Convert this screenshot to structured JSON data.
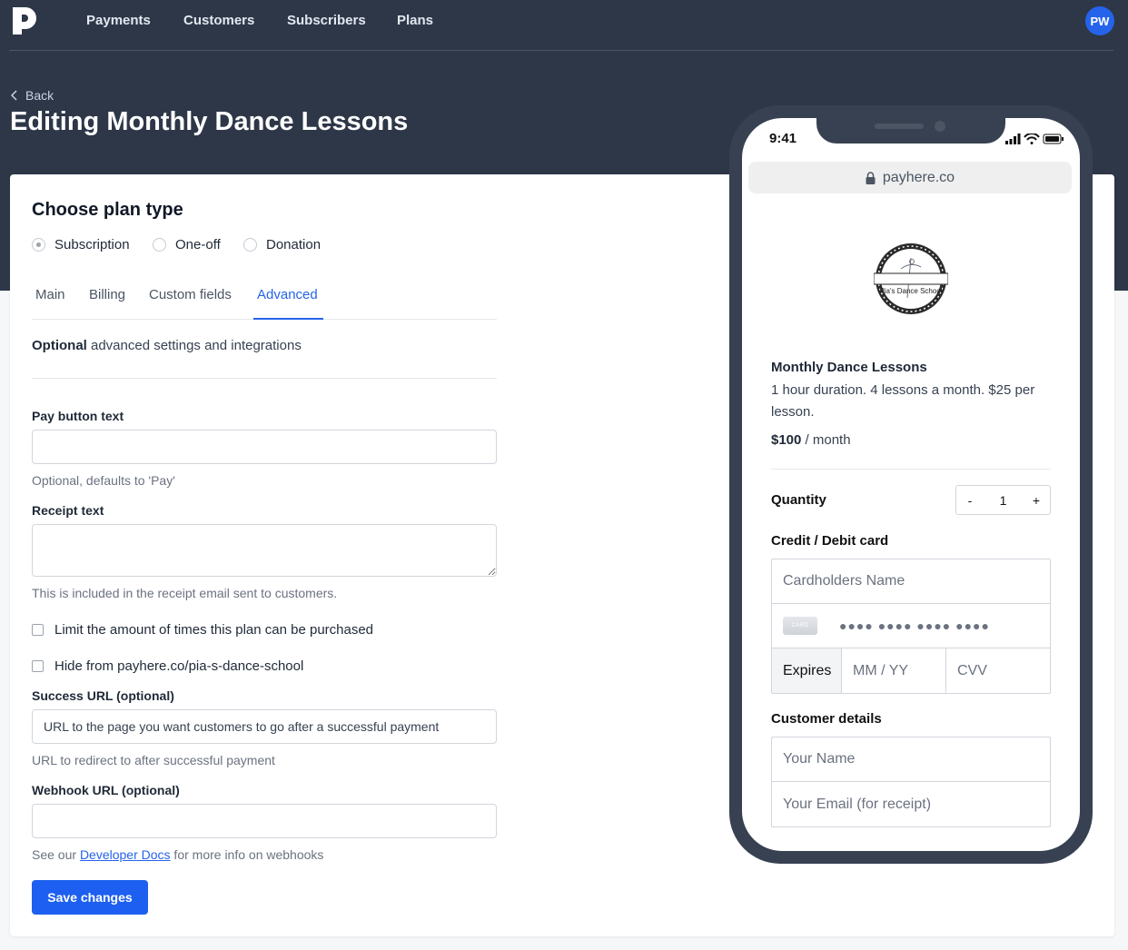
{
  "nav": {
    "items": [
      "Payments",
      "Customers",
      "Subscribers",
      "Plans"
    ],
    "avatar_initials": "PW"
  },
  "header": {
    "back_label": "Back",
    "title": "Editing Monthly Dance Lessons"
  },
  "plan_type": {
    "title": "Choose plan type",
    "options": [
      "Subscription",
      "One-off",
      "Donation"
    ],
    "selected": "Subscription"
  },
  "tabs": {
    "items": [
      "Main",
      "Billing",
      "Custom fields",
      "Advanced"
    ],
    "active": "Advanced"
  },
  "advanced": {
    "intro_bold": "Optional",
    "intro_rest": " advanced settings and integrations",
    "pay_button_label": "Pay button text",
    "pay_button_value": "",
    "pay_button_hint": "Optional, defaults to 'Pay'",
    "receipt_label": "Receipt text",
    "receipt_value": "",
    "receipt_hint": "This is included in the receipt email sent to customers.",
    "limit_label": "Limit the amount of times this plan can be purchased",
    "hide_label": "Hide from payhere.co/pia-s-dance-school",
    "success_label": "Success URL (optional)",
    "success_placeholder": "URL to the page you want customers to go after a successful payment",
    "success_hint": "URL to redirect to after successful payment",
    "webhook_label": "Webhook URL (optional)",
    "webhook_value": "",
    "webhook_hint_pre": "See our ",
    "webhook_hint_link": "Developer Docs",
    "webhook_hint_post": " for more info on webhooks",
    "save_label": "Save changes"
  },
  "preview": {
    "time": "9:41",
    "url": "payhere.co",
    "logo_text": "Pia's Dance School",
    "plan_name": "Monthly Dance Lessons",
    "plan_description": "1 hour duration. 4 lessons a month. $25 per lesson.",
    "price_amount": "$100",
    "price_period": " / month",
    "quantity_label": "Quantity",
    "quantity_minus": "-",
    "quantity_value": "1",
    "quantity_plus": "+",
    "card_section": "Credit / Debit card",
    "cardholder_placeholder": "Cardholders Name",
    "card_icon_text": "CARD",
    "card_number_mask": "●●●● ●●●● ●●●● ●●●●",
    "expires_label": "Expires",
    "expiry_placeholder": "MM / YY",
    "cvv_placeholder": "CVV",
    "customer_section": "Customer details",
    "name_placeholder": "Your Name",
    "email_placeholder": "Your Email (for receipt)"
  },
  "colors": {
    "header_bg": "#2d3748",
    "accent": "#2563eb",
    "phone_frame": "#374151"
  }
}
